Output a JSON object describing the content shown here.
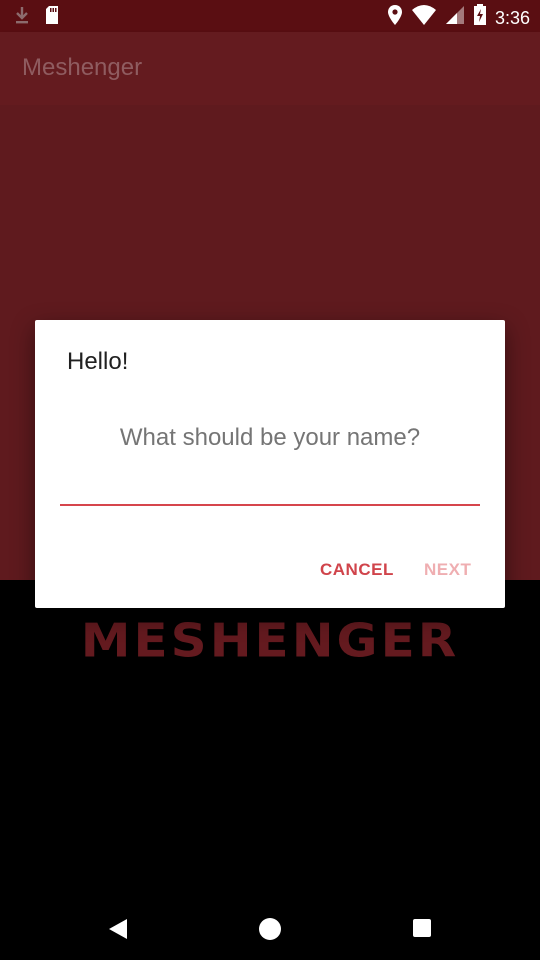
{
  "status_bar": {
    "time": "3:36",
    "left_icons": [
      "download-icon",
      "sd-card-icon"
    ],
    "right_icons": [
      "location-icon",
      "wifi-icon",
      "signal-icon",
      "battery-icon"
    ]
  },
  "app_bar": {
    "title": "Meshenger"
  },
  "dialog": {
    "title": "Hello!",
    "hint": "What should be your name?",
    "input_value": "",
    "cancel_label": "CANCEL",
    "next_label": "NEXT"
  },
  "background": {
    "logo_text": "MESHENGER"
  },
  "nav_bar": {
    "icons": [
      "back-icon",
      "home-icon",
      "recents-icon"
    ]
  },
  "colors": {
    "status_bar": "#5a0e12",
    "app_bar": "#641b1f",
    "content": "#5f1a1e",
    "accent": "#d0444b",
    "disabled_accent": "#efaeb1"
  }
}
